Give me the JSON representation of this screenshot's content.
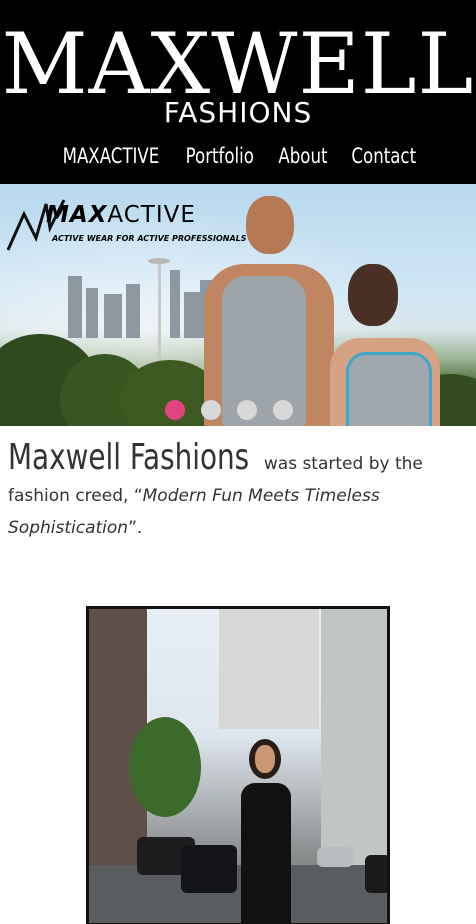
{
  "header": {
    "logo_main": "MAXWELL",
    "logo_sub": "FASHIONS",
    "nav": [
      "MAXACTIVE",
      "Portfolio",
      "About",
      "Contact"
    ]
  },
  "hero": {
    "brand_name_prefix": "MAX",
    "brand_name_suffix": "ACTIVE",
    "brand_tagline": "ACTIVE WEAR FOR ACTIVE PROFESSIONALS",
    "slides_total": 4,
    "slide_active": 1
  },
  "intro": {
    "title": "Maxwell Fashions",
    "text_before": " was started by the fashion creed, “",
    "quote": "Modern Fun Meets Timeless Sophistication",
    "text_after": "”."
  },
  "colors": {
    "header_bg": "#000000",
    "dot_active": "#e0457f",
    "dot_inactive": "#d8d8d8",
    "text": "#333333"
  }
}
